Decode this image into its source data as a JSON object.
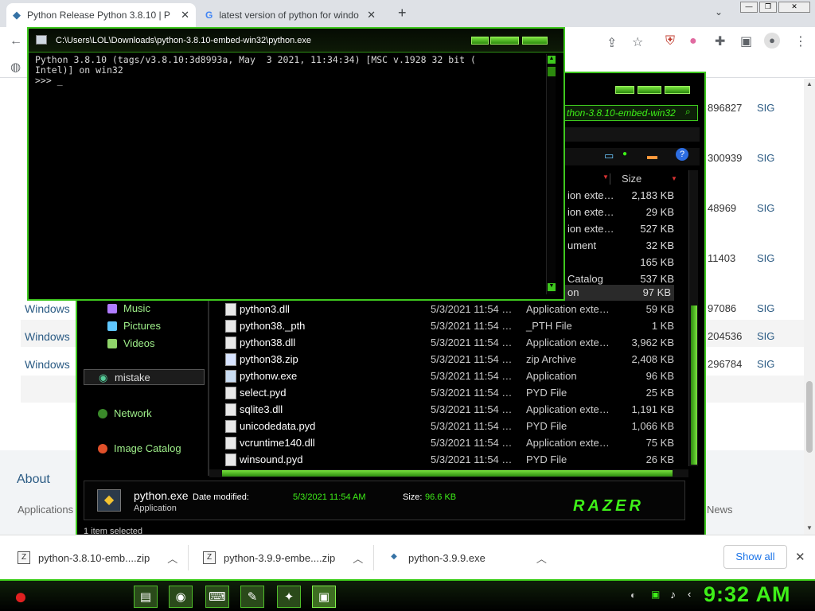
{
  "browser": {
    "tabs": [
      {
        "label": "Python Release Python 3.8.10 | P",
        "active": true
      },
      {
        "label": "latest version of python for windo",
        "active": false
      }
    ],
    "new_tab": "+",
    "minimize": "—",
    "restore": "❐",
    "close": "✕"
  },
  "page": {
    "windows_links": [
      "Windows",
      "Windows",
      "Windows"
    ],
    "row_numbers": [
      "896827",
      "300939",
      "48969",
      "11403",
      "97086",
      "204536",
      "296784"
    ],
    "sig_label": "SIG",
    "footer_about": "About",
    "footer_applications": "Applications",
    "footer_news": "News"
  },
  "console": {
    "title": "C:\\Users\\LOL\\Downloads\\python-3.8.10-embed-win32\\python.exe",
    "output": "Python 3.8.10 (tags/v3.8.10:3d8993a, May  3 2021, 11:34:34) [MSC v.1928 32 bit (\nIntel)] on win32\n>>> _"
  },
  "explorer": {
    "address": "thon-3.8.10-embed-win32",
    "column_size": "Size",
    "partial_rows": [
      {
        "type": "ion exte…",
        "size": "2,183 KB"
      },
      {
        "type": "ion exte…",
        "size": "29 KB"
      },
      {
        "type": "ion exte…",
        "size": "527 KB"
      },
      {
        "type": "ument",
        "size": "32 KB"
      },
      {
        "type": "",
        "size": "165 KB"
      },
      {
        "type": "Catalog",
        "size": "537 KB"
      },
      {
        "type": "on",
        "size": "97 KB"
      }
    ],
    "files": [
      {
        "name": "python3.dll",
        "date": "5/3/2021 11:54 …",
        "type": "Application exte…",
        "size": "59 KB"
      },
      {
        "name": "python38._pth",
        "date": "5/3/2021 11:54 …",
        "type": "_PTH File",
        "size": "1 KB"
      },
      {
        "name": "python38.dll",
        "date": "5/3/2021 11:54 …",
        "type": "Application exte…",
        "size": "3,962 KB"
      },
      {
        "name": "python38.zip",
        "date": "5/3/2021 11:54 …",
        "type": "zip Archive",
        "size": "2,408 KB"
      },
      {
        "name": "pythonw.exe",
        "date": "5/3/2021 11:54 …",
        "type": "Application",
        "size": "96 KB"
      },
      {
        "name": "select.pyd",
        "date": "5/3/2021 11:54 …",
        "type": "PYD File",
        "size": "25 KB"
      },
      {
        "name": "sqlite3.dll",
        "date": "5/3/2021 11:54 …",
        "type": "Application exte…",
        "size": "1,191 KB"
      },
      {
        "name": "unicodedata.pyd",
        "date": "5/3/2021 11:54 …",
        "type": "PYD File",
        "size": "1,066 KB"
      },
      {
        "name": "vcruntime140.dll",
        "date": "5/3/2021 11:54 …",
        "type": "Application exte…",
        "size": "75 KB"
      },
      {
        "name": "winsound.pyd",
        "date": "5/3/2021 11:54 …",
        "type": "PYD File",
        "size": "26 KB"
      }
    ],
    "nav": {
      "music": "Music",
      "pictures": "Pictures",
      "videos": "Videos",
      "mistake": "mistake",
      "network": "Network",
      "image_catalog": "Image Catalog"
    },
    "details": {
      "filename": "python.exe",
      "kind": "Application",
      "date_label": "Date modified:",
      "date_value": "5/3/2021 11:54 AM",
      "size_label": "Size:",
      "size_value": "96.6 KB",
      "brand": "RAZER"
    },
    "status": "1 item selected"
  },
  "downloads": {
    "items": [
      "python-3.8.10-emb....zip",
      "python-3.9.9-embe....zip",
      "python-3.9.9.exe"
    ],
    "show_all": "Show all"
  },
  "taskbar": {
    "clock": "9:32 AM"
  },
  "colors": {
    "accent_green": "#3ec81e",
    "link_blue": "#2b5b84",
    "clock_green": "#3ef018"
  }
}
